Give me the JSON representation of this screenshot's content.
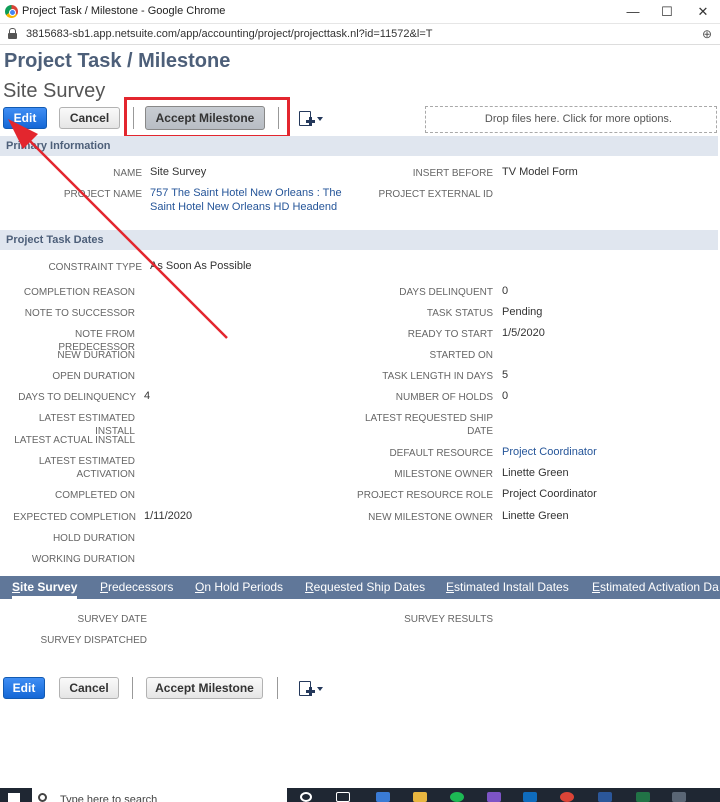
{
  "window": {
    "title": "Project Task / Milestone - Google Chrome",
    "minimize": "—",
    "maximize": "☐",
    "close": "✕"
  },
  "address": {
    "url": "3815683-sb1.app.netsuite.com/app/accounting/project/projecttask.nl?id=11572&l=T",
    "zoom_icon": "⊕"
  },
  "page": {
    "title": "Project Task / Milestone",
    "record_name": "Site Survey"
  },
  "toolbar": {
    "edit": "Edit",
    "cancel": "Cancel",
    "accept": "Accept Milestone",
    "drop": "Drop files here. Click for more options."
  },
  "sections": {
    "primary": "Primary Information",
    "dates": "Project Task Dates"
  },
  "primary_left": [
    {
      "label": "NAME",
      "value": "Site Survey"
    },
    {
      "label": "PROJECT NAME",
      "value": "757 The Saint Hotel New Orleans : The",
      "value2": "Saint Hotel New Orleans HD Headend"
    }
  ],
  "primary_right": [
    {
      "label": "INSERT BEFORE",
      "value": "TV Model Form"
    },
    {
      "label": "PROJECT EXTERNAL ID",
      "value": ""
    }
  ],
  "dates_left": [
    {
      "label": "CONSTRAINT TYPE",
      "value": "As Soon As Possible"
    },
    {
      "label": "COMPLETION REASON",
      "value": ""
    },
    {
      "label": "NOTE TO SUCCESSOR",
      "value": ""
    },
    {
      "label": "NOTE FROM PREDECESSOR",
      "value": ""
    },
    {
      "label": "NEW DURATION",
      "value": ""
    },
    {
      "label": "OPEN DURATION",
      "value": ""
    },
    {
      "label": "DAYS TO DELINQUENCY",
      "value": "4"
    },
    {
      "label": "LATEST ESTIMATED INSTALL",
      "value": ""
    },
    {
      "label": "LATEST ACTUAL INSTALL",
      "value": ""
    },
    {
      "label": "LATEST ESTIMATED",
      "label2": "ACTIVATION",
      "value": ""
    },
    {
      "label": "COMPLETED ON",
      "value": ""
    },
    {
      "label": "EXPECTED COMPLETION",
      "value": "1/11/2020"
    },
    {
      "label": "HOLD DURATION",
      "value": ""
    },
    {
      "label": "WORKING DURATION",
      "value": ""
    }
  ],
  "dates_right": [
    {
      "label": "DAYS DELINQUENT",
      "value": "0"
    },
    {
      "label": "TASK STATUS",
      "value": "Pending"
    },
    {
      "label": "READY TO START",
      "value": "1/5/2020"
    },
    {
      "label": "STARTED ON",
      "value": ""
    },
    {
      "label": "TASK LENGTH IN DAYS",
      "value": "5"
    },
    {
      "label": "NUMBER OF HOLDS",
      "value": "0"
    },
    {
      "label": "LATEST REQUESTED SHIP",
      "label2": "DATE",
      "value": ""
    },
    {
      "label": "DEFAULT RESOURCE",
      "value": "Project Coordinator"
    },
    {
      "label": "MILESTONE OWNER",
      "value": "Linette Green"
    },
    {
      "label": "PROJECT RESOURCE ROLE",
      "value": "Project Coordinator"
    },
    {
      "label": "NEW MILESTONE OWNER",
      "value": "Linette Green"
    }
  ],
  "tabs": [
    {
      "first": "S",
      "rest": "ite Survey"
    },
    {
      "first": "P",
      "rest": "redecessors"
    },
    {
      "first": "O",
      "rest": "n Hold Periods"
    },
    {
      "first": "R",
      "rest": "equested Ship Dates"
    },
    {
      "first": "E",
      "rest": "stimated Install Dates"
    },
    {
      "first": "E",
      "rest": "stimated Activation Da"
    }
  ],
  "survey": {
    "date_label": "SURVEY DATE",
    "dispatched_label": "SURVEY DISPATCHED",
    "results_label": "SURVEY RESULTS"
  },
  "taskbar": {
    "search_placeholder": "Type here to search"
  },
  "colors": {
    "annotation_red": "#e3262e",
    "tab_bar": "#607799",
    "section_bg": "#e0e6ef",
    "primary_button": "#1467d6"
  }
}
